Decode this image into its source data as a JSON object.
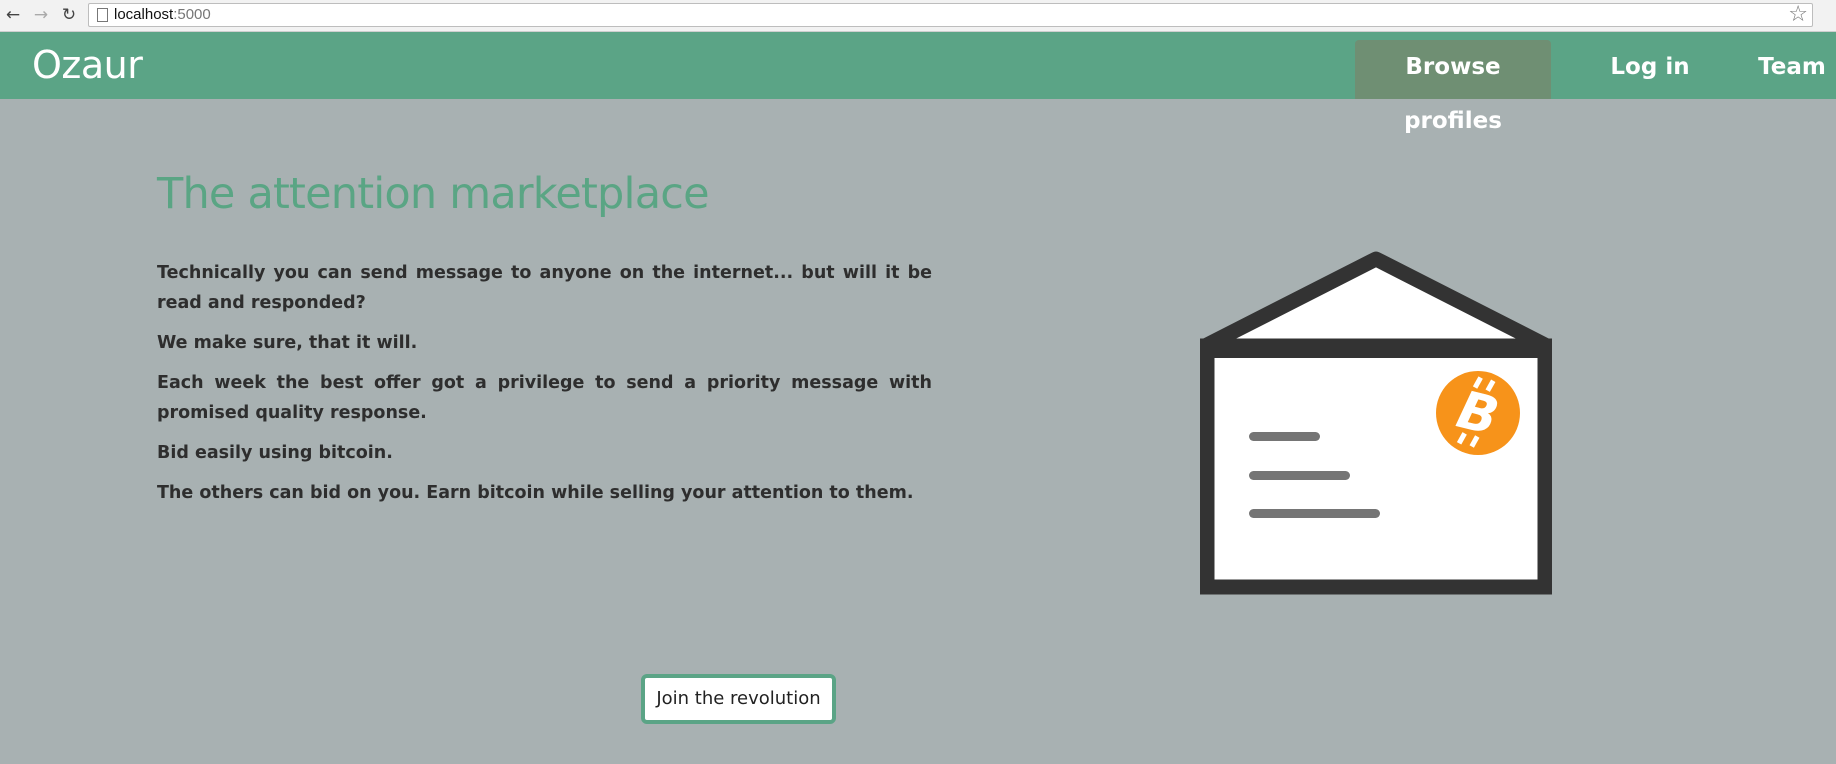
{
  "browser": {
    "url_host": "localhost",
    "url_port": ":5000",
    "back_icon": "arrow-left-icon",
    "forward_icon": "arrow-right-icon",
    "reload_icon": "reload-icon",
    "bookmark_icon": "star-icon"
  },
  "navbar": {
    "brand": "Ozaur",
    "items": [
      {
        "label": "Browse profiles",
        "active": true
      },
      {
        "label": "Log in",
        "active": false
      },
      {
        "label": "Team",
        "active": false
      }
    ]
  },
  "hero": {
    "title": "The attention marketplace",
    "paragraphs": [
      "Technically you can send message to anyone on the internet... but will it be read and responded?",
      "We make sure, that it will.",
      "Each week the best offer got a privilege to send a priority message with promised quality response.",
      "Bid easily using bitcoin.",
      "The others can bid on you. Earn bitcoin while selling your attention to them."
    ],
    "illustration": "envelope-bitcoin-icon",
    "cta_label": "Join the revolution"
  },
  "colors": {
    "accent": "#5ba486",
    "background": "#a8b1b2",
    "active_nav": "#6f8f73",
    "bitcoin": "#f7931a"
  }
}
